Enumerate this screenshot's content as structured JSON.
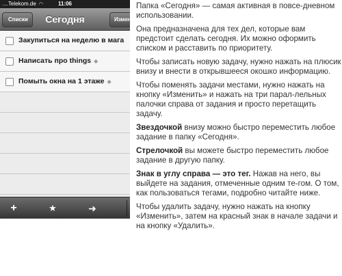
{
  "status_bar": {
    "carrier": "....Telekom.de",
    "time": "11:06"
  },
  "nav_bar": {
    "back_label": "Списки",
    "title": "Сегодня",
    "edit_label": "Измен"
  },
  "tasks": [
    {
      "label": "Закупиться на неделю в мага",
      "tagged": false
    },
    {
      "label": "Написать про things",
      "tagged": true
    },
    {
      "label": "Помыть окна на 1 этаже",
      "tagged": true
    }
  ],
  "toolbar": {
    "add_icon": "plus-icon",
    "star_icon": "star-icon",
    "move_icon": "arrow-right-icon"
  },
  "article": {
    "p1": "Папка «Сегодня» — самая активная в повсе-дневном использовании.",
    "p2": "Она предназначена для тех дел, которые вам предстоит сделать сегодня. Их можно оформить списком и расставить по приоритету.",
    "p3": "Чтобы записать новую задачу, нужно нажать на плюсик внизу и внести в открывшееся окошко информацию.",
    "p4": "Чтобы поменять задачи местами, нужно нажать на кнопку «Изменить» и нажать на три парал-лельных палочки справа от задания и просто перетащить задачу.",
    "p5_bold": "Звездочкой",
    "p5_rest": " внизу можно быстро переместить любое задание в папку «Сегодня».",
    "p6_bold": "Стрелочкой",
    "p6_rest": " вы можете быстро переместить любое задание в другую папку.",
    "p7_bold": "Знак в углу справа — это тег.",
    "p7_rest": " Нажав на него, вы выйдете на задания, отмеченные одним те-гом. О том, как пользоваться тегами, подробно читайте ниже.",
    "p8": "Чтобы удалить задачу, нужно нажать на кнопку «Изменить», затем на красный знак в начале задачи и на кнопку «Удалить»."
  }
}
